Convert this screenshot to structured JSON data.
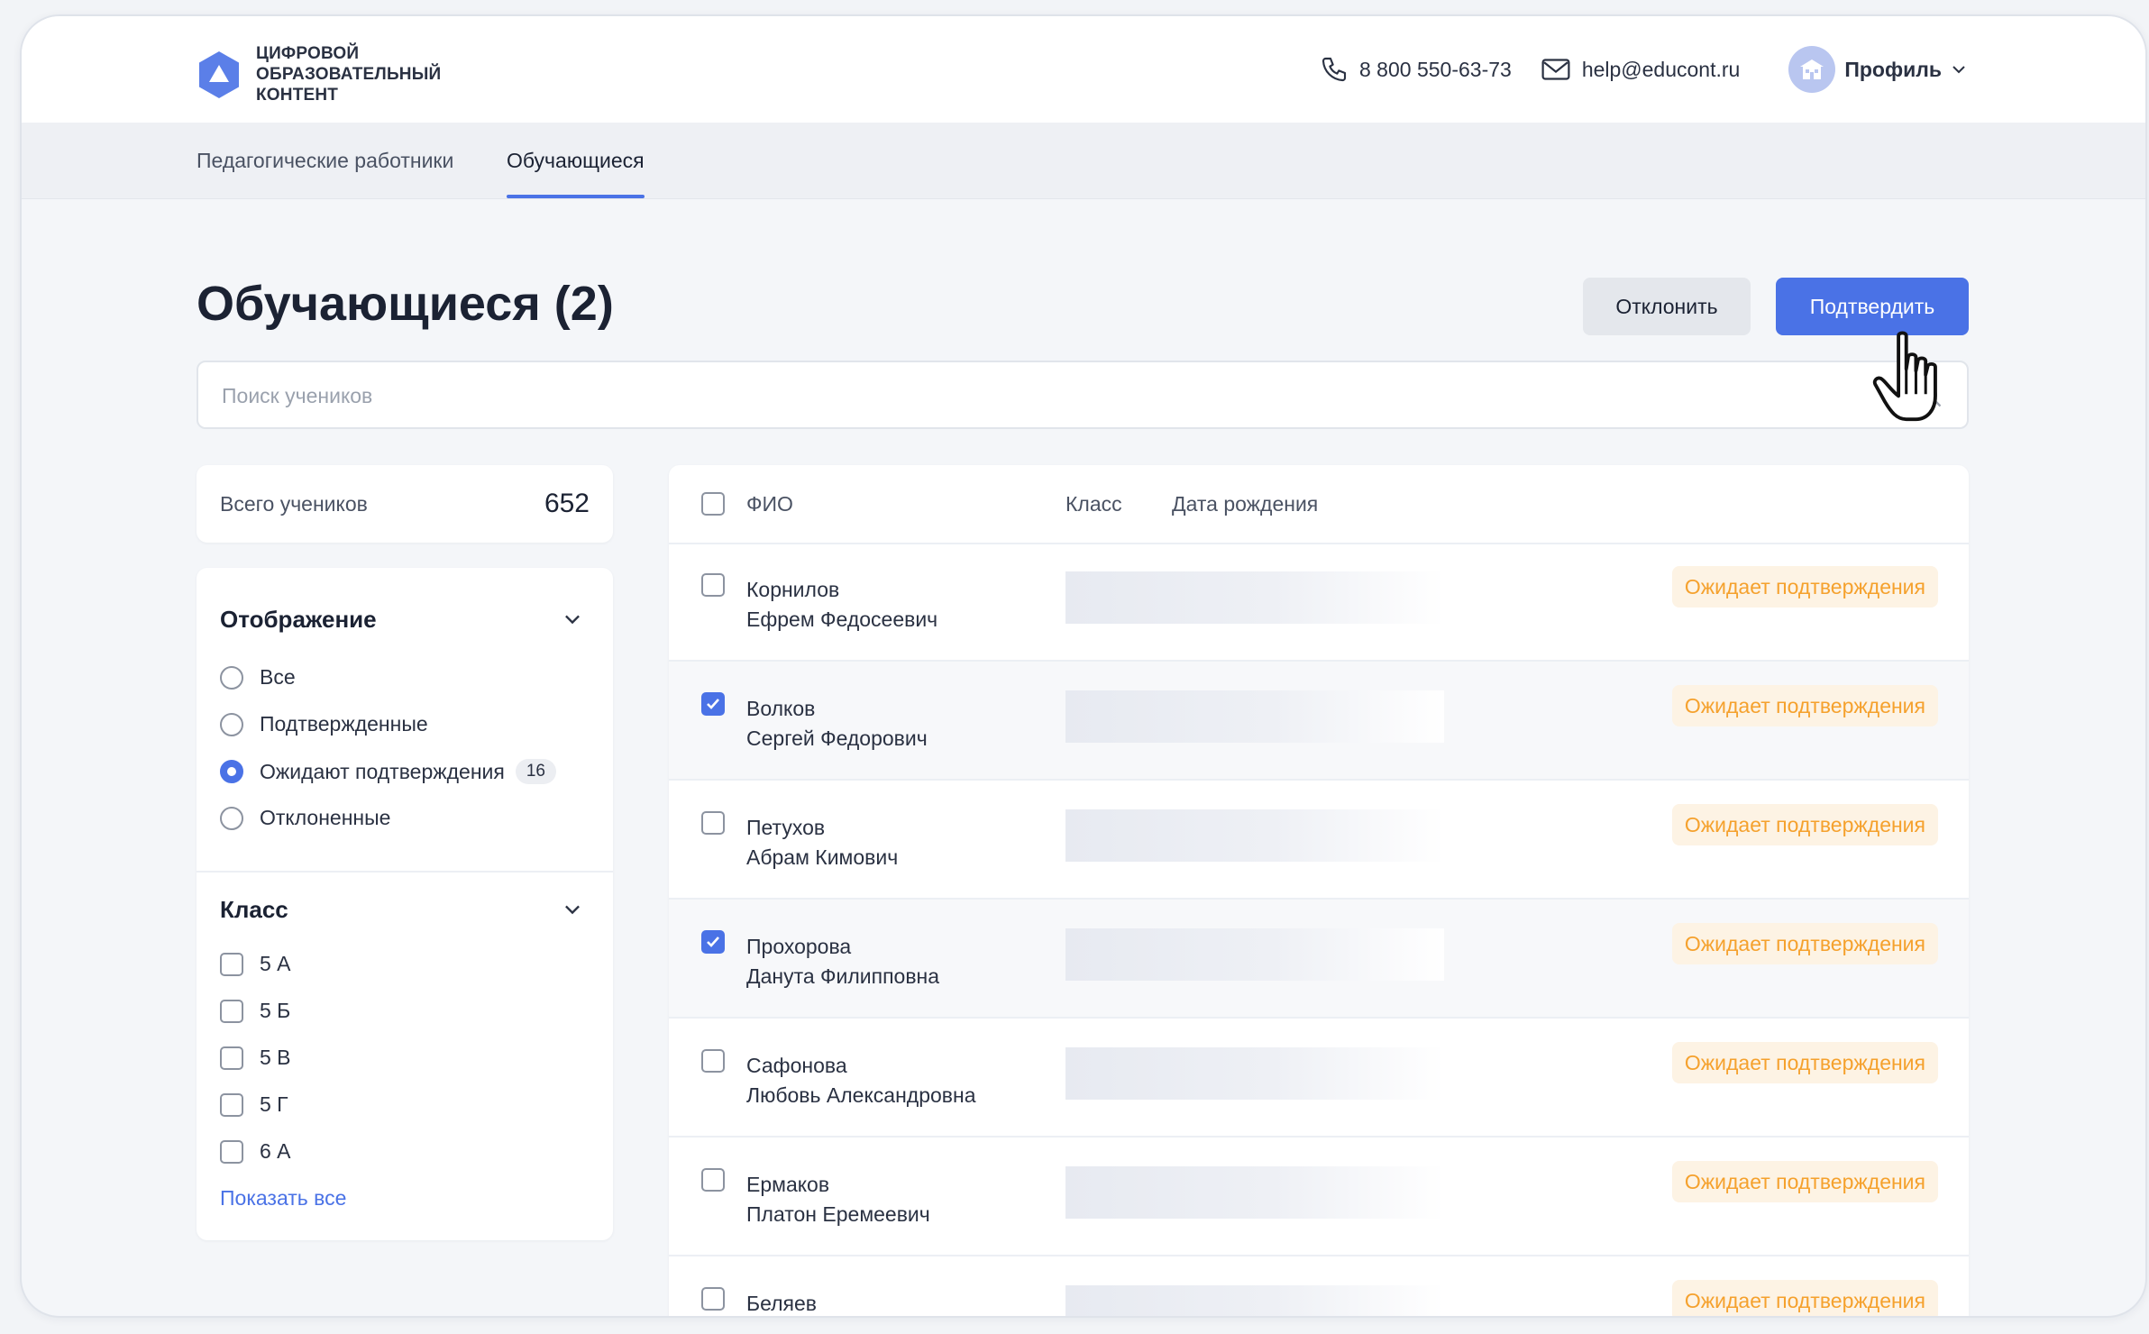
{
  "header": {
    "logo_line1": "Цифровой",
    "logo_line2": "образовательный",
    "logo_line3": "контент",
    "phone": "8 800 550-63-73",
    "email": "help@educont.ru",
    "profile_label": "Профиль"
  },
  "tabs": [
    {
      "label": "Педагогические работники",
      "active": false
    },
    {
      "label": "Обучающиеся",
      "active": true
    }
  ],
  "page": {
    "title": "Обучающиеся (2)",
    "reject_label": "Отклонить",
    "confirm_label": "Подтвердить",
    "search_placeholder": "Поиск учеников"
  },
  "summary": {
    "total_label": "Всего учеников",
    "total_value": "652"
  },
  "filters": {
    "display_title": "Отображение",
    "display_options": [
      {
        "label": "Все",
        "selected": false
      },
      {
        "label": "Подтвержденные",
        "selected": false
      },
      {
        "label": "Ожидают подтверждения",
        "selected": true,
        "badge": "16"
      },
      {
        "label": "Отклоненные",
        "selected": false
      }
    ],
    "class_title": "Класс",
    "class_options": [
      {
        "label": "5 А",
        "checked": false
      },
      {
        "label": "5 Б",
        "checked": false
      },
      {
        "label": "5 В",
        "checked": false
      },
      {
        "label": "5 Г",
        "checked": false
      },
      {
        "label": "6 А",
        "checked": false
      }
    ],
    "show_all_label": "Показать все"
  },
  "table": {
    "col_name": "ФИО",
    "col_class": "Класс",
    "col_birth": "Дата рождения",
    "rows": [
      {
        "last": "Корнилов",
        "first": "Ефрем Федосеевич",
        "checked": false,
        "status": "Ожидает подтверждения"
      },
      {
        "last": "Волков",
        "first": "Сергей Федорович",
        "checked": true,
        "status": "Ожидает подтверждения"
      },
      {
        "last": "Петухов",
        "first": "Абрам Кимович",
        "checked": false,
        "status": "Ожидает подтверждения"
      },
      {
        "last": "Прохорова",
        "first": "Данута Филипповна",
        "checked": true,
        "status": "Ожидает подтверждения"
      },
      {
        "last": "Сафонова",
        "first": "Любовь Александровна",
        "checked": false,
        "status": "Ожидает подтверждения"
      },
      {
        "last": "Ермаков",
        "first": "Платон Еремеевич",
        "checked": false,
        "status": "Ожидает подтверждения"
      },
      {
        "last": "Беляев",
        "first": "",
        "checked": false,
        "status": "Ожидает подтверждения"
      }
    ]
  },
  "colors": {
    "accent": "#4a72e6",
    "status_text": "#f5a12d",
    "status_bg": "#fdf3e4"
  }
}
